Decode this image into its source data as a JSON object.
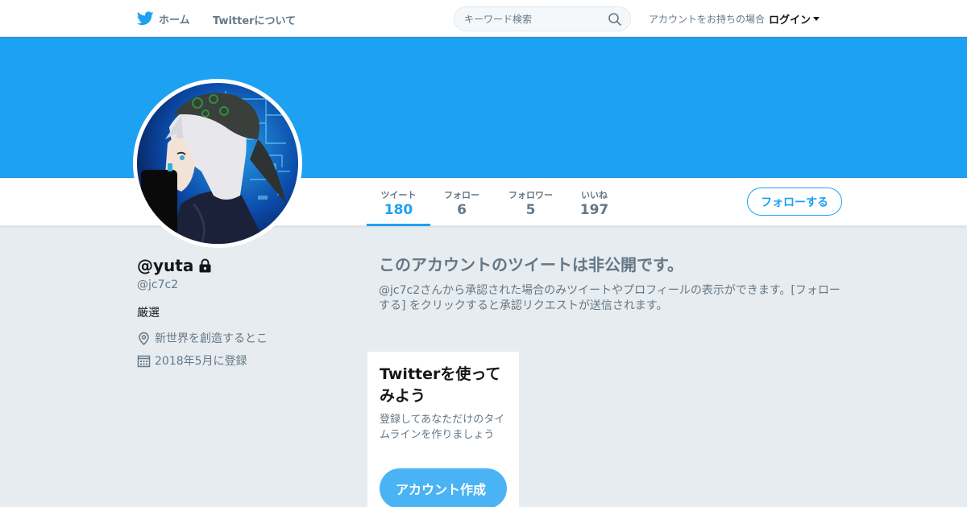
{
  "nav": {
    "home_label": "ホーム",
    "about_label": "Twitterについて",
    "search_placeholder": "キーワード検索",
    "login_prompt": "アカウントをお持ちの場合",
    "login_label": "ログイン"
  },
  "stats": [
    {
      "label": "ツイート",
      "value": "180"
    },
    {
      "label": "フォロー",
      "value": "6"
    },
    {
      "label": "フォロワー",
      "value": "5"
    },
    {
      "label": "いいね",
      "value": "197"
    }
  ],
  "follow_button": "フォローする",
  "profile": {
    "name": "@yuta",
    "handle": "@jc7c2",
    "bio": "厳選",
    "location": "新世界を創造するとこ",
    "joined": "2018年5月に登録"
  },
  "protected": {
    "title": "このアカウントのツイートは非公開です。",
    "description": "@jc7c2さんから承認された場合のみツイートやプロフィールの表示ができます。[フォローする] をクリックすると承認リクエストが送信されます。"
  },
  "signup_card": {
    "title": "Twitterを使ってみよう",
    "description": "登録してあなただけのタイムラインを作りましょう",
    "button": "アカウント作成"
  },
  "colors": {
    "accent": "#1da1f2",
    "background": "#e6ecf0",
    "secondary_text": "#657786"
  }
}
